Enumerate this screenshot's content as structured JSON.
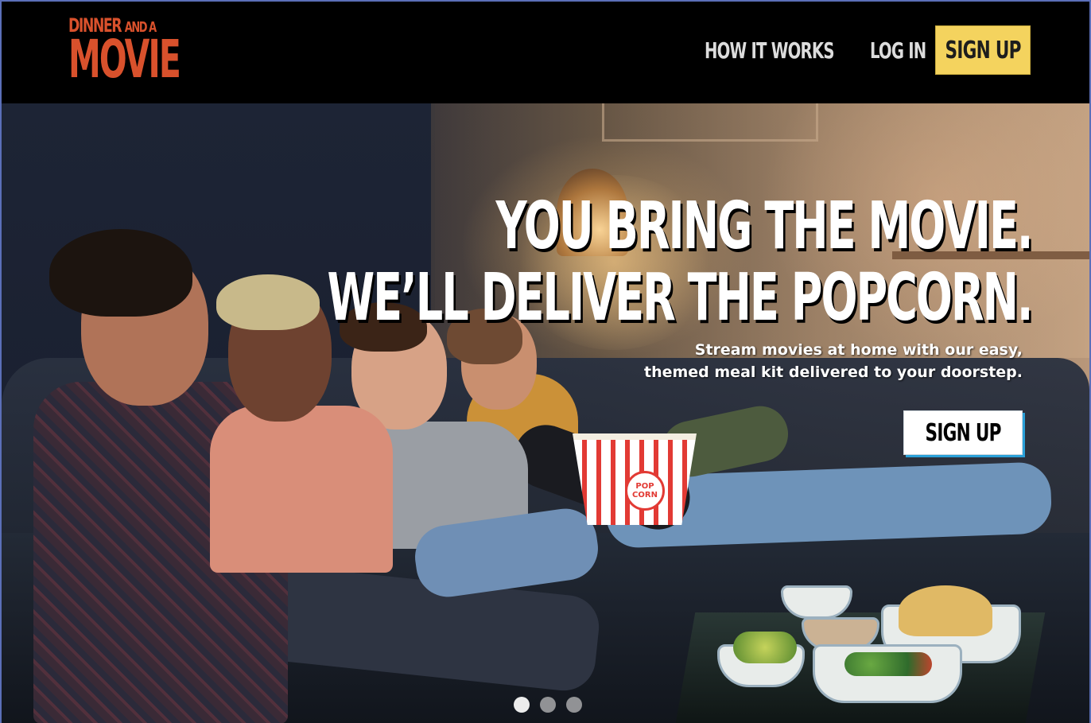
{
  "brand": {
    "line1": "DINNER",
    "line1_small": "AND A",
    "line2": "MOVIE",
    "color": "#d9512c"
  },
  "nav": {
    "how_it_works": "HOW IT WORKS",
    "log_in": "LOG IN",
    "sign_up": "SIGN UP",
    "sign_up_color": "#f4d35e"
  },
  "hero": {
    "headline_line1": "YOU BRING THE MOVIE.",
    "headline_line2": "WE’LL DELIVER THE POPCORN.",
    "subtext_line1": "Stream movies at home with our easy,",
    "subtext_line2": "themed meal kit delivered to your doorstep.",
    "cta_label": "SIGN UP",
    "popcorn_label": "POP CORN"
  },
  "carousel": {
    "slides": 3,
    "active_index": 0
  }
}
